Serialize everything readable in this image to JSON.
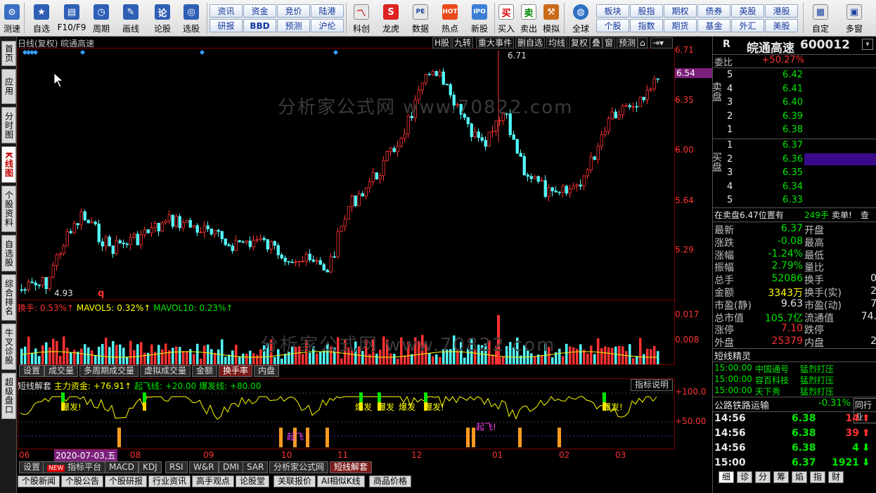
{
  "toolbar": {
    "buttons": [
      {
        "label": "测速",
        "icon": "speed-icon",
        "color": "#3a6fc4"
      },
      {
        "label": "自选",
        "icon": "star-icon",
        "color": "#2f5fb5"
      },
      {
        "label": "F10/F9",
        "icon": "f10-icon",
        "color": "#2f5fb5"
      },
      {
        "label": "周期",
        "icon": "clock-icon",
        "color": "#2f5fb5"
      },
      {
        "label": "画线",
        "icon": "pen-icon",
        "color": "#2f5fb5"
      },
      {
        "label": "论股",
        "icon": "discuss-icon",
        "color": "#2f5fb5"
      },
      {
        "label": "选股",
        "icon": "select-icon",
        "color": "#2f5fb5"
      }
    ],
    "pills_top": [
      "资讯",
      "资金",
      "竞价",
      "陆港"
    ],
    "pills_bottom": [
      "研报",
      "BBD",
      "预测",
      "沪伦"
    ],
    "buttons2": [
      {
        "label": "科创",
        "icon": "kechuang-icon"
      },
      {
        "label": "龙虎",
        "icon": "dragon-icon"
      },
      {
        "label": "数据",
        "icon": "data-icon"
      },
      {
        "label": "热点",
        "icon": "hot-icon"
      },
      {
        "label": "新股",
        "icon": "ipo-icon"
      },
      {
        "label": "买入",
        "icon": "buy-icon"
      },
      {
        "label": "卖出",
        "icon": "sell-icon"
      },
      {
        "label": "模拟",
        "icon": "hammer-icon"
      },
      {
        "label": "全球",
        "icon": "globe-icon"
      }
    ],
    "pills2_top": [
      "板块",
      "股指",
      "期权",
      "债券",
      "英股",
      "港股"
    ],
    "pills2_bottom": [
      "个股",
      "指数",
      "期货",
      "基金",
      "外汇",
      "美股"
    ],
    "buttons3": [
      {
        "label": "自定",
        "icon": "custom-icon"
      },
      {
        "label": "多窗",
        "icon": "multiwin-icon"
      }
    ]
  },
  "left_tabs": [
    "首页",
    "应用",
    "分时图",
    "K线图",
    "个股资料",
    "自选股",
    "综合排名",
    "牛叉诊股",
    "超级盘口"
  ],
  "chart": {
    "title": "日线(复权) 皖通高速",
    "buttons": [
      "H股",
      "九转",
      "重大事件",
      "删自选",
      "均线",
      "复权",
      "叠",
      "窗",
      "预测"
    ],
    "price_labels": [
      "6.71",
      "6.35",
      "6.00",
      "5.64",
      "5.29"
    ],
    "current_price": "6.54",
    "high_label": "6.71",
    "low_label": "4.93",
    "marker_q": "q",
    "vol_header": {
      "a": "换手: 0.53%↑",
      "b": "MAVOL5: 0.32%↑",
      "c": "MAVOL10: 0.23%↑"
    },
    "vol_labels": [
      "0.017",
      "0.008"
    ],
    "sub_tabs": [
      "设置",
      "成交量",
      "多周期成交量",
      "虚拟成交量",
      "金额",
      "换手率",
      "内盘"
    ],
    "ind_header": {
      "a": "短线解套",
      "b": "主力资金: +76.91↑",
      "c": "起飞线: +20.00",
      "d": "爆发线: +80.00"
    },
    "ind_button": "指标说明",
    "ind_labels": [
      "+100.0",
      "+50.00"
    ],
    "ind_texts": [
      "爆发!",
      "爆发",
      "爆发",
      "爆发",
      "爆发!",
      "起飞",
      "起飞!",
      "爆发!"
    ],
    "x_labels": [
      "06",
      "2020-07-03,五",
      "08",
      "09",
      "10",
      "11",
      "12",
      "01",
      "02",
      "03"
    ],
    "watermark": "分析家公式网 www.70822.com",
    "bottom_tabs": [
      "设置",
      "指标平台",
      "MACD",
      "KDJ",
      "RSI",
      "W&R",
      "DMI",
      "SAR",
      "分析家公式网",
      "短线解套"
    ],
    "bottom_new": "NEW",
    "news_tabs": [
      "个股新闻",
      "个股公告",
      "个股研报",
      "行业资讯",
      "高手观点",
      "论股堂",
      "关联报价",
      "AI相似K线",
      "商品价格"
    ],
    "colors": {
      "up": "#ff3232",
      "down": "#54fcfc",
      "ma": "#ffff00"
    }
  },
  "right": {
    "code_prefix": "R",
    "name": "皖通高速",
    "code": "600012",
    "webi_label": "委比",
    "webi_value": "+50.27%",
    "sell_label": "卖盘",
    "buy_label": "买盘",
    "asks": [
      {
        "n": "5",
        "p": "6.42"
      },
      {
        "n": "4",
        "p": "6.41"
      },
      {
        "n": "3",
        "p": "6.40"
      },
      {
        "n": "2",
        "p": "6.39"
      },
      {
        "n": "1",
        "p": "6.38"
      }
    ],
    "bids": [
      {
        "n": "1",
        "p": "6.37"
      },
      {
        "n": "2",
        "p": "6.36"
      },
      {
        "n": "3",
        "p": "6.35"
      },
      {
        "n": "4",
        "p": "6.34"
      },
      {
        "n": "5",
        "p": "6.33"
      }
    ],
    "notice": {
      "a": "在卖盘6.47位置有",
      "b": "249手",
      "c": "卖单!",
      "d": "查"
    },
    "stats": [
      {
        "l": "最新",
        "v": "6.37",
        "vc": "green",
        "l2": "开盘"
      },
      {
        "l": "涨跌",
        "v": "-0.08",
        "vc": "green",
        "l2": "最高"
      },
      {
        "l": "涨幅",
        "v": "-1.24%",
        "vc": "green",
        "l2": "最低"
      },
      {
        "l": "振幅",
        "v": "2.79%",
        "vc": "green",
        "l2": "量比"
      },
      {
        "l": "总手",
        "v": "52086",
        "vc": "green",
        "l2": "换手",
        "v2": "0"
      },
      {
        "l": "金额",
        "v": "3343万",
        "vc": "yellow",
        "l2": "换手(实)",
        "v2": "2"
      },
      {
        "l": "市盈(静)",
        "v": "9.63",
        "vc": "white",
        "l2": "市盈(动)",
        "v2": "7"
      },
      {
        "l": "总市值",
        "v": "105.7亿",
        "vc": "green",
        "l2": "流通值",
        "v2": "74."
      },
      {
        "l": "涨停",
        "v": "7.10",
        "vc": "red",
        "l2": "跌停"
      },
      {
        "l": "外盘",
        "v": "25379",
        "vc": "red",
        "l2": "内盘",
        "v2": "2"
      }
    ],
    "spirit_title": "短线精灵",
    "spirit": [
      {
        "t": "15:00:00",
        "n": "中国通号",
        "s": "猛烈打压"
      },
      {
        "t": "15:00:00",
        "n": "容百科技",
        "s": "猛烈打压"
      },
      {
        "t": "15:00:00",
        "n": "天下秀",
        "s": "猛烈打压"
      }
    ],
    "sector": {
      "name": "公路铁路运输",
      "pct": "-0.31%",
      "link": "同行业"
    },
    "ticks": [
      {
        "t": "14:56",
        "p": "6.38",
        "v": "14",
        "dir": "up"
      },
      {
        "t": "14:56",
        "p": "6.38",
        "v": "39",
        "dir": "up"
      },
      {
        "t": "14:56",
        "p": "6.38",
        "v": "4",
        "dir": "down"
      },
      {
        "t": "15:00",
        "p": "6.37",
        "v": "1921",
        "dir": "down"
      }
    ],
    "bottom_tabs": [
      "细",
      "诊",
      "分",
      "筹",
      "焰",
      "指",
      "财"
    ]
  }
}
